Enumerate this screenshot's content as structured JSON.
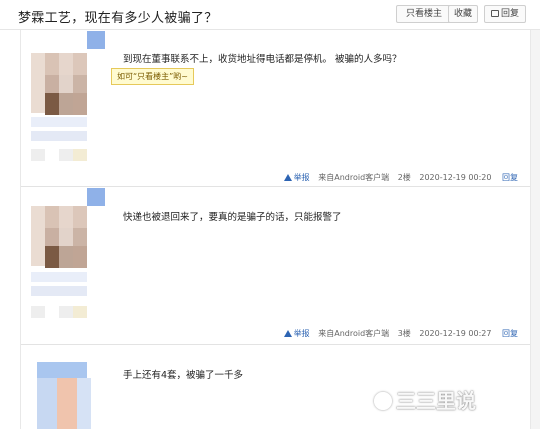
{
  "header": {
    "title": "梦霖工艺，现在有多少人被骗了？",
    "only_op_label": "只看楼主",
    "favorite_label": "收藏",
    "reply_label": "回复"
  },
  "tooltip": "如可“只看楼主”哟~",
  "posts": [
    {
      "text": "到现在董事联系不上，收货地址得电话都是停机。 被骗的人多吗？",
      "report": "举报",
      "client": "来自Android客户端",
      "floor": "2楼",
      "time": "2020-12-19 00:20",
      "reply": "回复"
    },
    {
      "text": "快递也被退回来了，要真的是骗子的话，只能报警了",
      "report": "举报",
      "client": "来自Android客户端",
      "floor": "3楼",
      "time": "2020-12-19 00:27",
      "reply": "回复"
    },
    {
      "text": "手上还有4套，被骗了一千多"
    }
  ],
  "watermark": "三三里说"
}
